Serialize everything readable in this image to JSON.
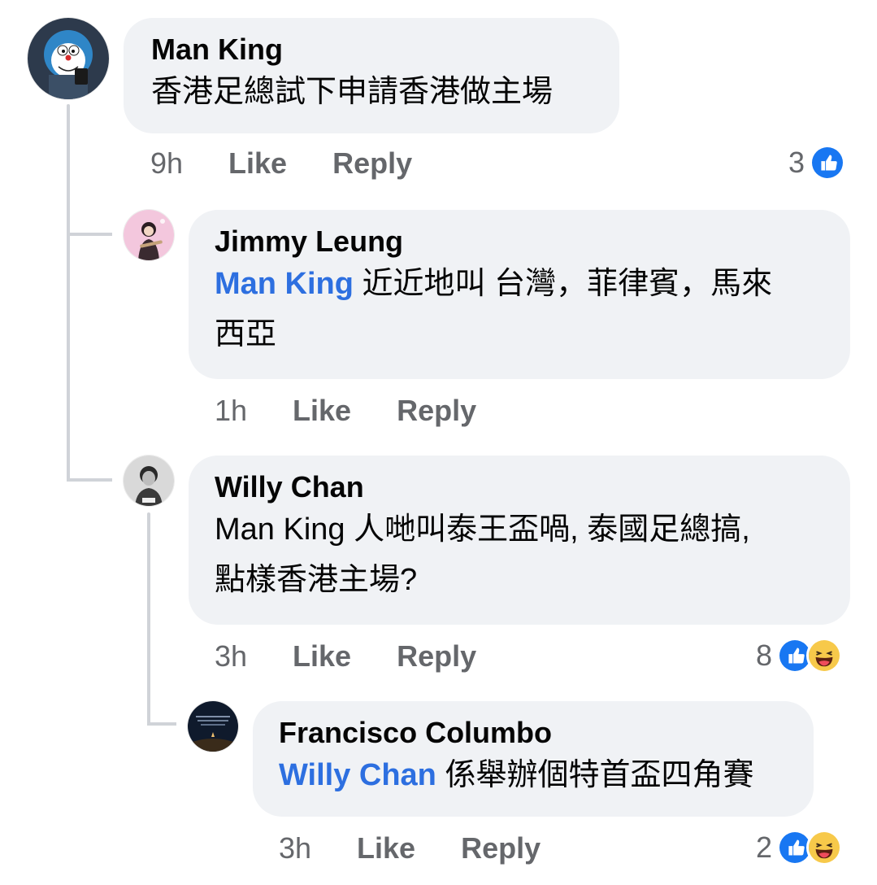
{
  "comments": [
    {
      "author": "Man King",
      "mention": "",
      "text": "香港足總試下申請香港做主場",
      "time": "9h",
      "like": "Like",
      "reply": "Reply",
      "reaction_count": "3",
      "reactions": [
        "like-icon"
      ]
    },
    {
      "author": "Jimmy Leung",
      "mention": "Man King",
      "text_line1": " 近近地叫 台灣，菲律賓，馬來",
      "text_line2": "西亞",
      "time": "1h",
      "like": "Like",
      "reply": "Reply"
    },
    {
      "author": "Willy Chan",
      "mention": "",
      "text_line1": "Man King 人哋叫泰王盃喎, 泰國足總搞,",
      "text_line2": "點樣香港主場?",
      "time": "3h",
      "like": "Like",
      "reply": "Reply",
      "reaction_count": "8",
      "reactions": [
        "like-icon",
        "haha-icon"
      ]
    },
    {
      "author": "Francisco Columbo",
      "mention": "Willy Chan",
      "text": " 係舉辦個特首盃四角賽",
      "time": "3h",
      "like": "Like",
      "reply": "Reply",
      "reaction_count": "2",
      "reactions": [
        "like-icon",
        "haha-icon"
      ]
    }
  ],
  "colors": {
    "bubble": "#f0f2f5",
    "mention": "#2d6fe0",
    "meta": "#65676b",
    "like_blue": "#1877f2",
    "haha_yellow": "#f7c94a"
  }
}
